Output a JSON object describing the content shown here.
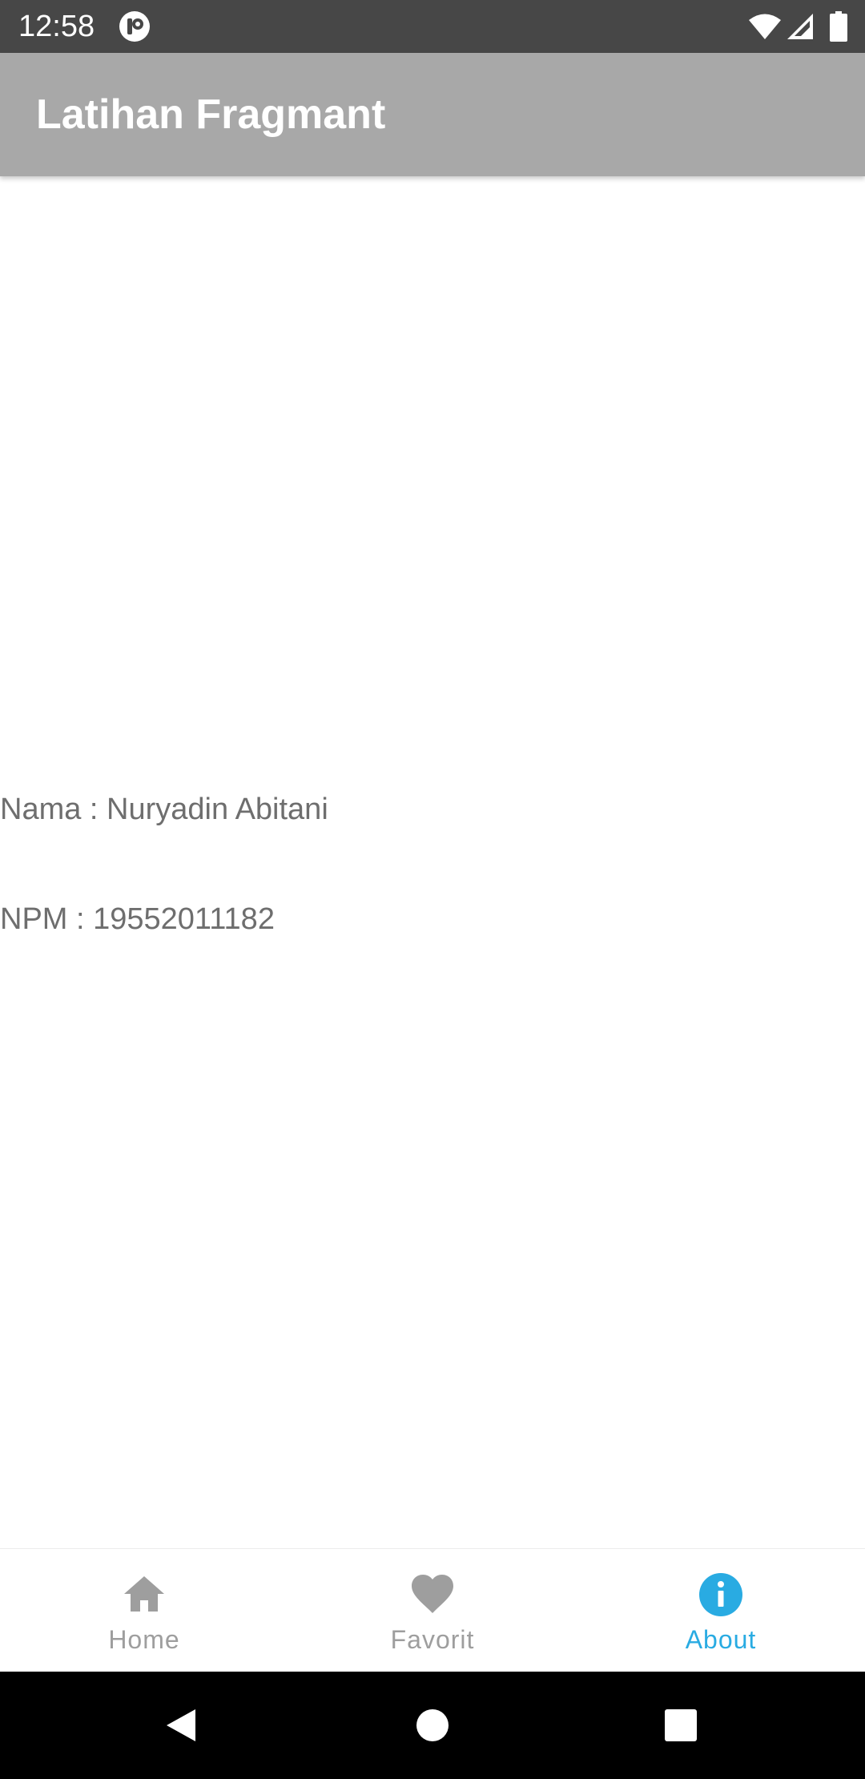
{
  "status_bar": {
    "time": "12:58",
    "background": "#474747"
  },
  "app_bar": {
    "title": "Latihan Fragmant",
    "background": "#a8a8a8"
  },
  "content": {
    "name_line": "Nama : Nuryadin Abitani",
    "npm_line": "NPM : 19552011182"
  },
  "bottom_nav": {
    "accent_color": "#29abe2",
    "inactive_color": "#9e9e9e",
    "items": [
      {
        "label": "Home",
        "icon": "home-icon",
        "active": false
      },
      {
        "label": "Favorit",
        "icon": "heart-icon",
        "active": false
      },
      {
        "label": "About",
        "icon": "info-icon",
        "active": true
      }
    ]
  },
  "system_nav": {
    "buttons": [
      "back-icon",
      "home-circle-icon",
      "recents-icon"
    ]
  }
}
